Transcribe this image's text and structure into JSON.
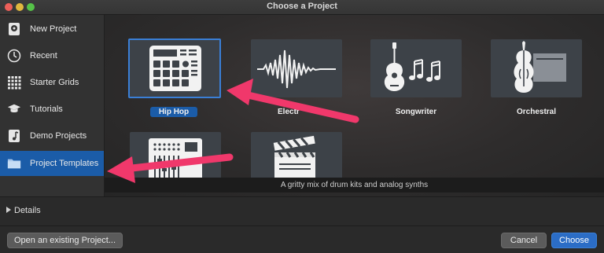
{
  "window": {
    "title": "Choose a Project"
  },
  "sidebar": {
    "items": [
      {
        "label": "New Project",
        "icon": "new-project-icon"
      },
      {
        "label": "Recent",
        "icon": "clock-icon"
      },
      {
        "label": "Starter Grids",
        "icon": "grid-icon"
      },
      {
        "label": "Tutorials",
        "icon": "graduation-cap-icon"
      },
      {
        "label": "Demo Projects",
        "icon": "music-note-icon"
      },
      {
        "label": "Project Templates",
        "icon": "folder-icon",
        "selected": true
      }
    ]
  },
  "templates": {
    "tiles": [
      {
        "label": "Hip Hop",
        "icon": "drum-machine-icon",
        "selected": true
      },
      {
        "label": "Electr",
        "icon": "waveform-icon"
      },
      {
        "label": "Songwriter",
        "icon": "guitar-notes-icon"
      },
      {
        "label": "Orchestral",
        "icon": "violin-icon"
      },
      {
        "label": "",
        "icon": "mixer-icon"
      },
      {
        "label": "",
        "icon": "clapperboard-icon"
      }
    ],
    "description": "A gritty mix of drum kits and analog synths"
  },
  "details": {
    "label": "Details"
  },
  "footer": {
    "open_label": "Open an existing Project...",
    "cancel_label": "Cancel",
    "choose_label": "Choose"
  },
  "colors": {
    "selection": "#1b5ca8",
    "annotation_arrow": "#f0386b",
    "primary_button": "#2b6dc6"
  }
}
